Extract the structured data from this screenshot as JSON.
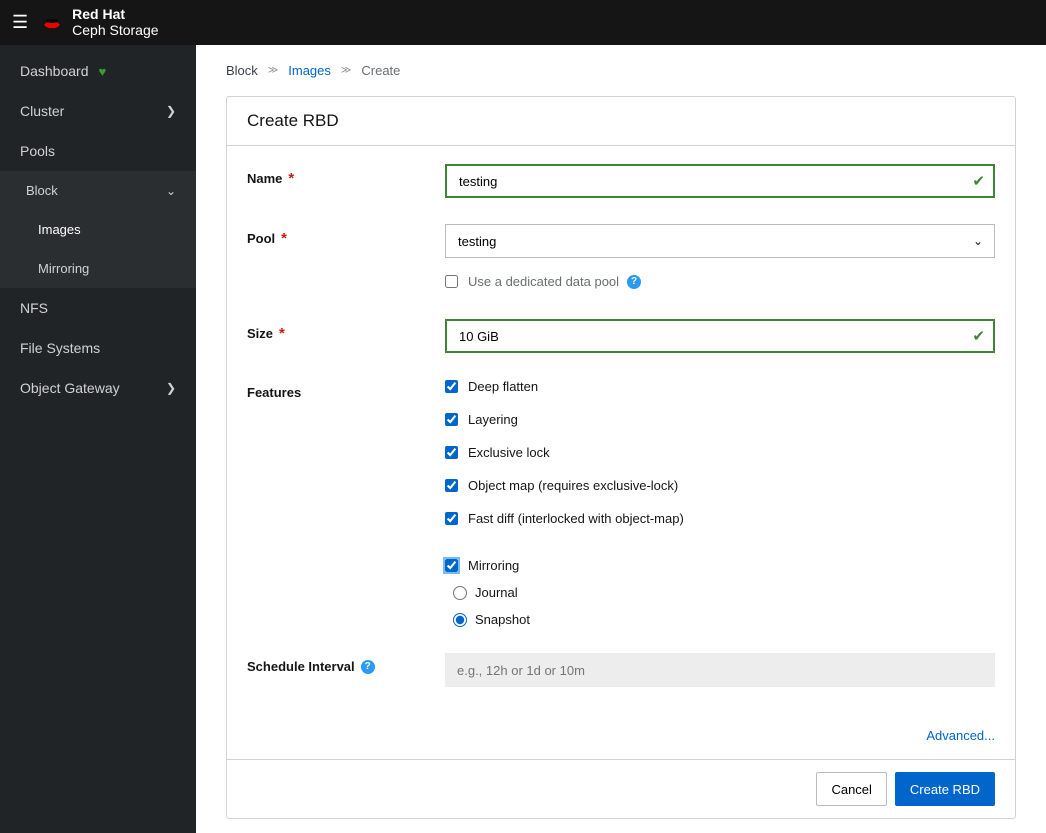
{
  "brand": {
    "line1": "Red Hat",
    "line2": "Ceph Storage"
  },
  "sidebar": {
    "dashboard": "Dashboard",
    "cluster": "Cluster",
    "pools": "Pools",
    "block": "Block",
    "block_images": "Images",
    "block_mirroring": "Mirroring",
    "nfs": "NFS",
    "filesystems": "File Systems",
    "objgw": "Object Gateway"
  },
  "breadcrumb": {
    "root": "Block",
    "images": "Images",
    "create": "Create"
  },
  "card": {
    "title": "Create RBD",
    "name_label": "Name",
    "name_value": "testing",
    "pool_label": "Pool",
    "pool_value": "testing",
    "dedicated_label": "Use a dedicated data pool",
    "size_label": "Size",
    "size_value": "10 GiB",
    "features_label": "Features",
    "features": {
      "deep_flatten": "Deep flatten",
      "layering": "Layering",
      "exclusive_lock": "Exclusive lock",
      "object_map": "Object map (requires exclusive-lock)",
      "fast_diff": "Fast diff (interlocked with object-map)",
      "mirroring": "Mirroring",
      "journal": "Journal",
      "snapshot": "Snapshot"
    },
    "schedule_label": "Schedule Interval",
    "schedule_placeholder": "e.g., 12h or 1d or 10m",
    "advanced": "Advanced...",
    "cancel": "Cancel",
    "submit": "Create RBD"
  }
}
